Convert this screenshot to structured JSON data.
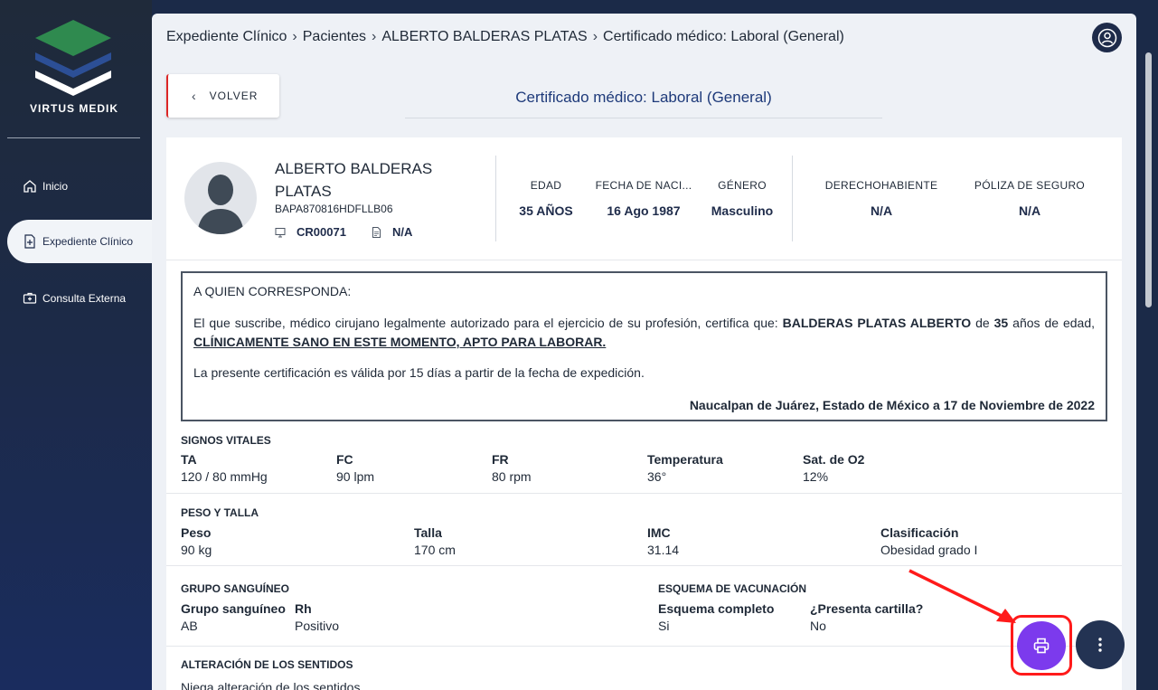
{
  "brand": {
    "name": "VIRTUS MEDIK"
  },
  "sidebar": {
    "items": [
      {
        "label": "Inicio",
        "icon": "home-icon"
      },
      {
        "label": "Expediente Clínico",
        "icon": "file-plus-icon",
        "active": true
      },
      {
        "label": "Consulta Externa",
        "icon": "medical-case-icon"
      }
    ]
  },
  "breadcrumb": [
    "Expediente Clínico",
    "Pacientes",
    "ALBERTO BALDERAS PLATAS",
    "Certificado médico: Laboral (General)"
  ],
  "header": {
    "back_label": "VOLVER",
    "title": "Certificado médico: Laboral (General)"
  },
  "patient": {
    "name": "ALBERTO BALDERAS PLATAS",
    "curp": "BAPA870816HDFLLB06",
    "record_id": "CR00071",
    "document": "N/A",
    "stats": [
      {
        "label": "EDAD",
        "value": "35 AÑOS"
      },
      {
        "label": "FECHA DE NACI...",
        "value": "16 Ago 1987"
      },
      {
        "label": "GÉNERO",
        "value": "Masculino"
      },
      {
        "label": "DERECHOHABIENTE",
        "value": "N/A"
      },
      {
        "label": "PÓLIZA DE SEGURO",
        "value": "N/A"
      }
    ]
  },
  "certificate": {
    "greeting": "A QUIEN CORRESPONDA:",
    "body_pre": "El que suscribe, médico cirujano legalmente autorizado para el ejercicio de su profesión, certifica que:",
    "patient_name": "BALDERAS PLATAS ALBERTO",
    "body_mid": "de",
    "age": "35",
    "body_post": "años de edad,",
    "verdict": "CLÍNICAMENTE SANO EN ESTE MOMENTO, APTO PARA LABORAR.",
    "validity": "La presente certificación es válida por 15 días a partir de la fecha de expedición.",
    "place_date": "Naucalpan de Juárez, Estado de México a 17 de Noviembre de 2022"
  },
  "vitals": {
    "title": "SIGNOS VITALES",
    "fields": [
      {
        "label": "TA",
        "value": "120 / 80 mmHg"
      },
      {
        "label": "FC",
        "value": "90 lpm"
      },
      {
        "label": "FR",
        "value": "80 rpm"
      },
      {
        "label": "Temperatura",
        "value": "36°"
      },
      {
        "label": "Sat. de O2",
        "value": "12%"
      }
    ]
  },
  "weight": {
    "title": "PESO Y TALLA",
    "fields": [
      {
        "label": "Peso",
        "value": "90 kg"
      },
      {
        "label": "Talla",
        "value": "170 cm"
      },
      {
        "label": "IMC",
        "value": "31.14"
      },
      {
        "label": "Clasificación",
        "value": "Obesidad grado I"
      }
    ]
  },
  "blood": {
    "title": "GRUPO SANGUÍNEO",
    "fields": [
      {
        "label": "Grupo sanguíneo",
        "value": "AB"
      },
      {
        "label": "Rh",
        "value": "Positivo"
      }
    ]
  },
  "vaccination": {
    "title": "ESQUEMA DE VACUNACIÓN",
    "fields": [
      {
        "label": "Esquema completo",
        "value": "Si"
      },
      {
        "label": "¿Presenta cartilla?",
        "value": "No"
      }
    ]
  },
  "senses": {
    "title": "ALTERACIÓN DE LOS SENTIDOS",
    "value": "Niega alteración de los sentidos"
  },
  "colors": {
    "accent": "#7c3aed",
    "highlight": "#ff1a1a",
    "navy": "#1e2b4a"
  }
}
